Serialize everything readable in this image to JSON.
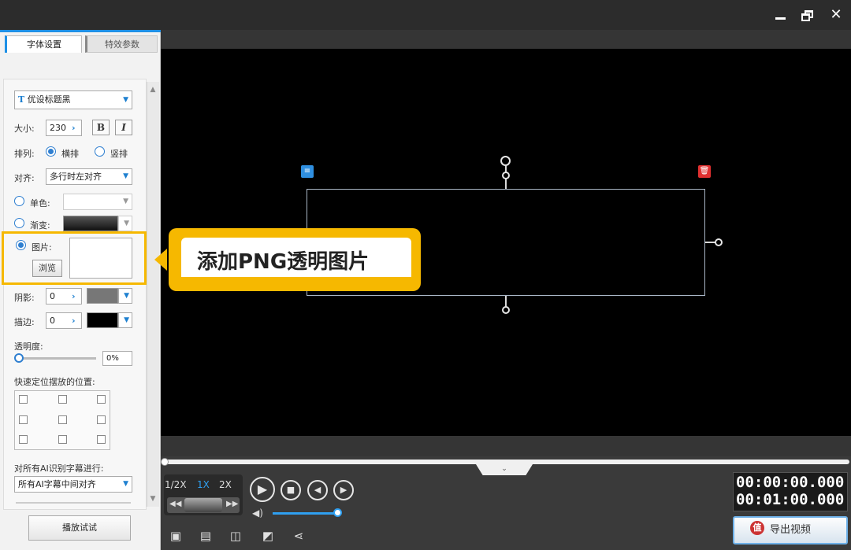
{
  "window": {
    "minimize_icon": "minimize-icon",
    "restore_icon": "restore-icon",
    "close_icon": "close-icon",
    "close_glyph": "✕"
  },
  "tabs": [
    {
      "label": "字体设置",
      "active": true
    },
    {
      "label": "特效参数",
      "active": false
    }
  ],
  "font": {
    "font_name": "优设标题黑",
    "size_label": "大小:",
    "size_value": "230",
    "bold": "B",
    "italic": "I",
    "arrange_label": "排列:",
    "arrange_horizontal": "横排",
    "arrange_vertical": "竖排",
    "arrange_selected": "横排",
    "align_label": "对齐:",
    "align_value": "多行时左对齐",
    "solid_label": "单色:",
    "gradient_label": "渐变:",
    "image_label": "图片:",
    "browse_label": "浏览",
    "shadow_label": "阴影:",
    "shadow_value": "0",
    "stroke_label": "描边:",
    "stroke_value": "0",
    "opacity_label": "透明度:",
    "opacity_value": "0%",
    "position_label": "快速定位摆放的位置:",
    "ai_label": "对所有AI识别字幕进行:",
    "ai_value": "所有AI字幕中间对齐",
    "preview_button": "播放试试"
  },
  "callout": {
    "text": "添加PNG透明图片",
    "color": "#f6b800"
  },
  "playback": {
    "speeds": [
      "1/2X",
      "1X",
      "2X"
    ],
    "active_speed": "1X",
    "current_time": "00:00:00.000",
    "total_time": "00:01:00.000",
    "volume_percent": 100
  },
  "toolbar_icons": [
    "save-icon",
    "open-folder-icon",
    "copy-icon",
    "save-as-icon",
    "share-icon"
  ],
  "export_button": "导出视频",
  "colors": {
    "accent": "#1e90e6",
    "highlight": "#f6b800",
    "delete": "#e03030"
  }
}
